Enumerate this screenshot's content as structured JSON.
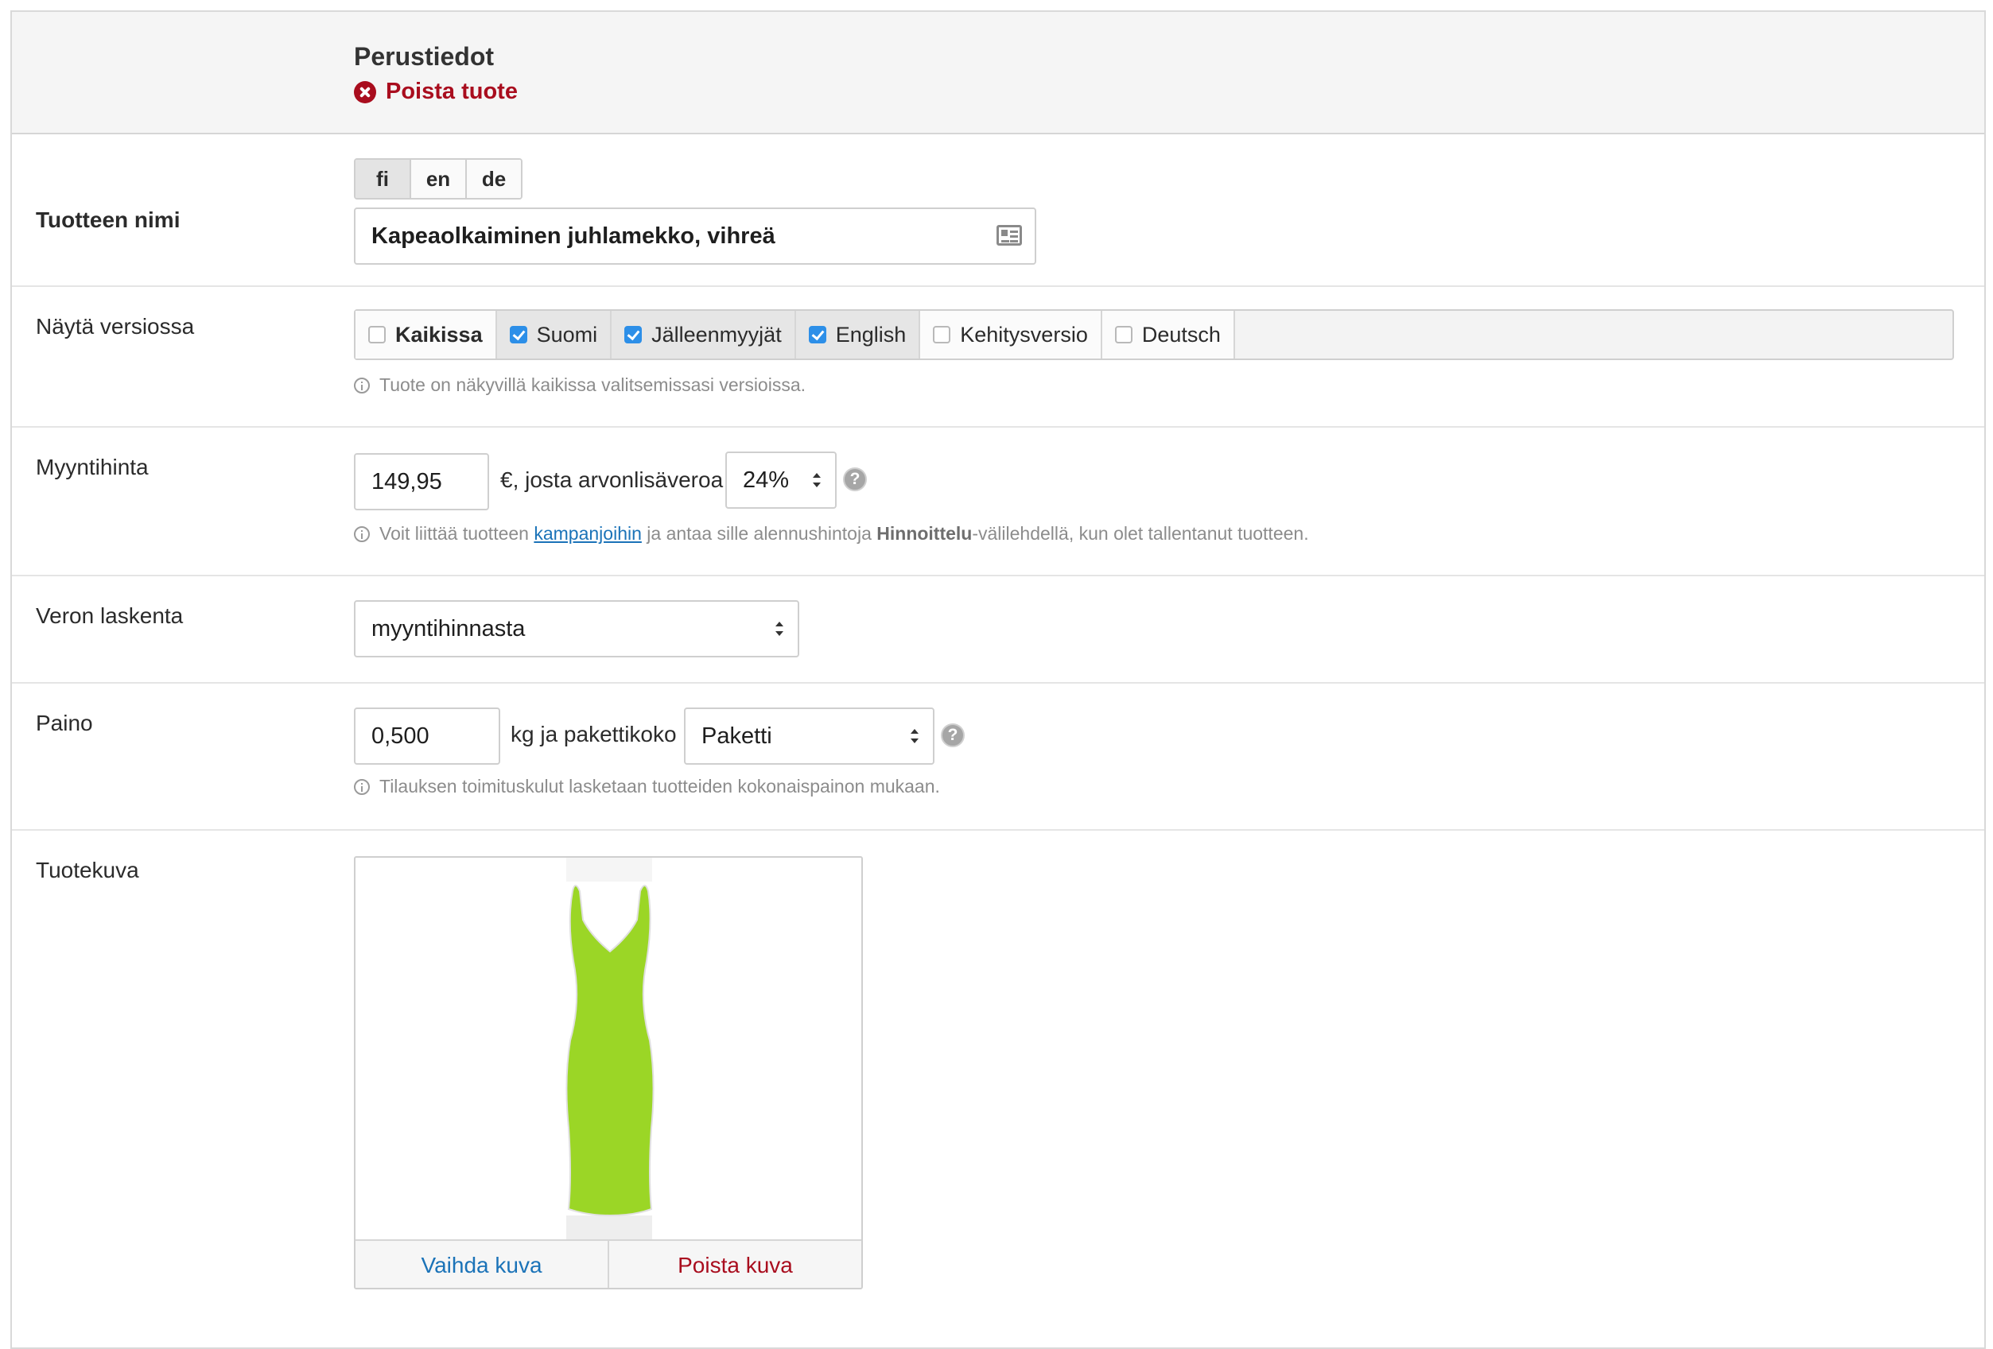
{
  "header": {
    "title": "Perustiedot",
    "delete_label": "Poista tuote"
  },
  "product_name": {
    "label": "Tuotteen nimi",
    "languages": [
      "fi",
      "en",
      "de"
    ],
    "active_language": "fi",
    "value": "Kapeaolkaiminen juhlamekko, vihreä"
  },
  "versions": {
    "label": "Näytä versiossa",
    "options": [
      {
        "label": "Kaikissa",
        "checked": false
      },
      {
        "label": "Suomi",
        "checked": true
      },
      {
        "label": "Jälleenmyyjät",
        "checked": true
      },
      {
        "label": "English",
        "checked": true
      },
      {
        "label": "Kehitysversio",
        "checked": false
      },
      {
        "label": "Deutsch",
        "checked": false
      }
    ],
    "hint": "Tuote on näkyvillä kaikissa valitsemissasi versioissa."
  },
  "price": {
    "label": "Myyntihinta",
    "value": "149,95",
    "vat_text": "€, josta arvonlisäveroa",
    "vat_value": "24%",
    "hint_part1": "Voit liittää tuotteen",
    "hint_link": "kampanjoihin",
    "hint_part2": "ja antaa sille alennushintoja",
    "hint_bold": "Hinnoittelu",
    "hint_part3": "-välilehdellä, kun olet tallentanut tuotteen."
  },
  "tax": {
    "label": "Veron laskenta",
    "value": "myyntihinnasta"
  },
  "weight": {
    "label": "Paino",
    "value": "0,500",
    "unit_text": "kg ja pakettikoko",
    "package_value": "Paketti",
    "hint": "Tilauksen toimituskulut lasketaan tuotteiden kokonaispainon mukaan."
  },
  "image": {
    "label": "Tuotekuva",
    "change_label": "Vaihda kuva",
    "remove_label": "Poista kuva",
    "dress_color": "#9bd626"
  },
  "help_symbol": "?",
  "colors": {
    "danger": "#a90d1e",
    "link": "#1b73b8",
    "checkbox": "#2d8fe8"
  }
}
